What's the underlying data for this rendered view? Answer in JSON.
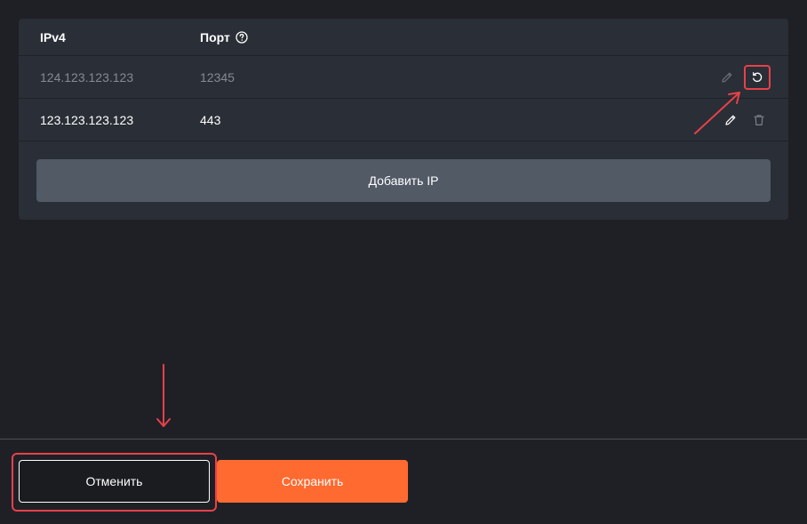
{
  "table": {
    "headers": {
      "ip": "IPv4",
      "port": "Порт"
    },
    "rows": [
      {
        "ip": "124.123.123.123",
        "port": "12345",
        "state": "disabled",
        "actions": [
          "edit-icon",
          "undo-icon"
        ]
      },
      {
        "ip": "123.123.123.123",
        "port": "443",
        "state": "active",
        "actions": [
          "edit-icon",
          "trash-icon"
        ]
      }
    ],
    "add_label": "Добавить IP"
  },
  "footer": {
    "cancel_label": "Отменить",
    "save_label": "Сохранить"
  },
  "colors": {
    "background": "#1f2026",
    "card": "#2a2e36",
    "add_button": "#525a66",
    "primary": "#ff6a30",
    "annotation": "#e8414a",
    "muted_text": "#858a93"
  }
}
